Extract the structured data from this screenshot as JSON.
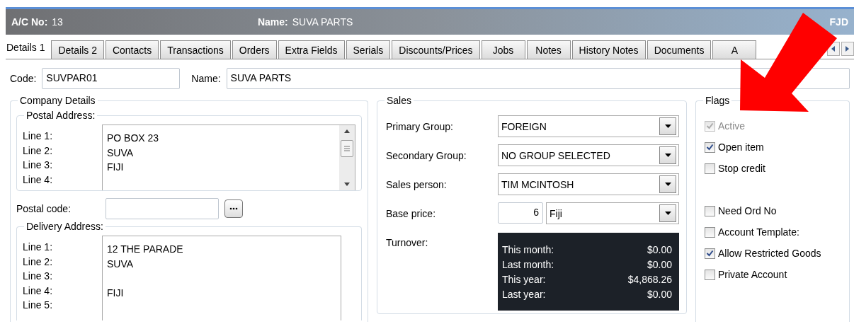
{
  "header": {
    "account_label": "A/C No:",
    "account_value": "13",
    "name_label": "Name:",
    "name_value": "SUVA PARTS",
    "currency": "FJD"
  },
  "tabs": [
    {
      "label": "Details 1",
      "selected": true
    },
    {
      "label": "Details 2",
      "selected": false
    },
    {
      "label": "Contacts",
      "selected": false
    },
    {
      "label": "Transactions",
      "selected": false
    },
    {
      "label": "Orders",
      "selected": false
    },
    {
      "label": "Extra Fields",
      "selected": false
    },
    {
      "label": "Serials",
      "selected": false
    },
    {
      "label": "Discounts/Prices",
      "selected": false
    },
    {
      "label": "Jobs",
      "selected": false
    },
    {
      "label": "Notes",
      "selected": false
    },
    {
      "label": "History Notes",
      "selected": false
    },
    {
      "label": "Documents",
      "selected": false
    },
    {
      "label": "A",
      "selected": false
    }
  ],
  "code": {
    "label": "Code:",
    "value": "SUVPAR01"
  },
  "name": {
    "label": "Name:",
    "value": "SUVA PARTS"
  },
  "company_details": {
    "title": "Company Details",
    "postal_address": {
      "title": "Postal Address:",
      "rows": [
        {
          "label": "Line 1:",
          "value": "PO BOX 23"
        },
        {
          "label": "Line 2:",
          "value": "SUVA"
        },
        {
          "label": "Line 3:",
          "value": "FIJI"
        },
        {
          "label": "Line 4:"
        }
      ]
    },
    "postal_code": {
      "label": "Postal code:"
    },
    "delivery_address": {
      "title": "Delivery Address:",
      "rows": [
        {
          "label": "Line 1:",
          "value": "12 THE PARADE"
        },
        {
          "label": "Line 2:",
          "value": "SUVA"
        },
        {
          "label": "Line 3:"
        },
        {
          "label": "Line 4:",
          "value": "FIJI"
        },
        {
          "label": "Line 5:"
        }
      ]
    }
  },
  "sales": {
    "title": "Sales",
    "fields": [
      {
        "label": "Primary Group:",
        "value": "FOREIGN"
      },
      {
        "label": "Secondary Group:",
        "value": "NO GROUP SELECTED"
      },
      {
        "label": "Sales person:",
        "value": "TIM MCINTOSH"
      }
    ],
    "base_price": {
      "label": "Base price:",
      "number": "6",
      "value": "Fiji"
    },
    "turnover": {
      "label": "Turnover:",
      "rows": [
        {
          "label": "This month:",
          "value": "$0.00"
        },
        {
          "label": "Last month:",
          "value": "$0.00"
        },
        {
          "label": "This year:",
          "value": "$4,868.26"
        },
        {
          "label": "Last year:",
          "value": "$0.00"
        }
      ]
    }
  },
  "flags": {
    "title": "Flags",
    "items": [
      {
        "label": "Active",
        "checked": true,
        "disabled": true
      },
      {
        "label": "Open item",
        "checked": true,
        "disabled": false
      },
      {
        "label": "Stop credit",
        "checked": false,
        "disabled": false,
        "gap_after": true
      },
      {
        "label": "Need Ord No",
        "checked": false,
        "disabled": false
      },
      {
        "label": "Account Template:",
        "checked": false,
        "disabled": false
      },
      {
        "label": "Allow Restricted Goods",
        "checked": true,
        "disabled": false
      },
      {
        "label": "Private Account",
        "checked": false,
        "disabled": false
      }
    ]
  }
}
